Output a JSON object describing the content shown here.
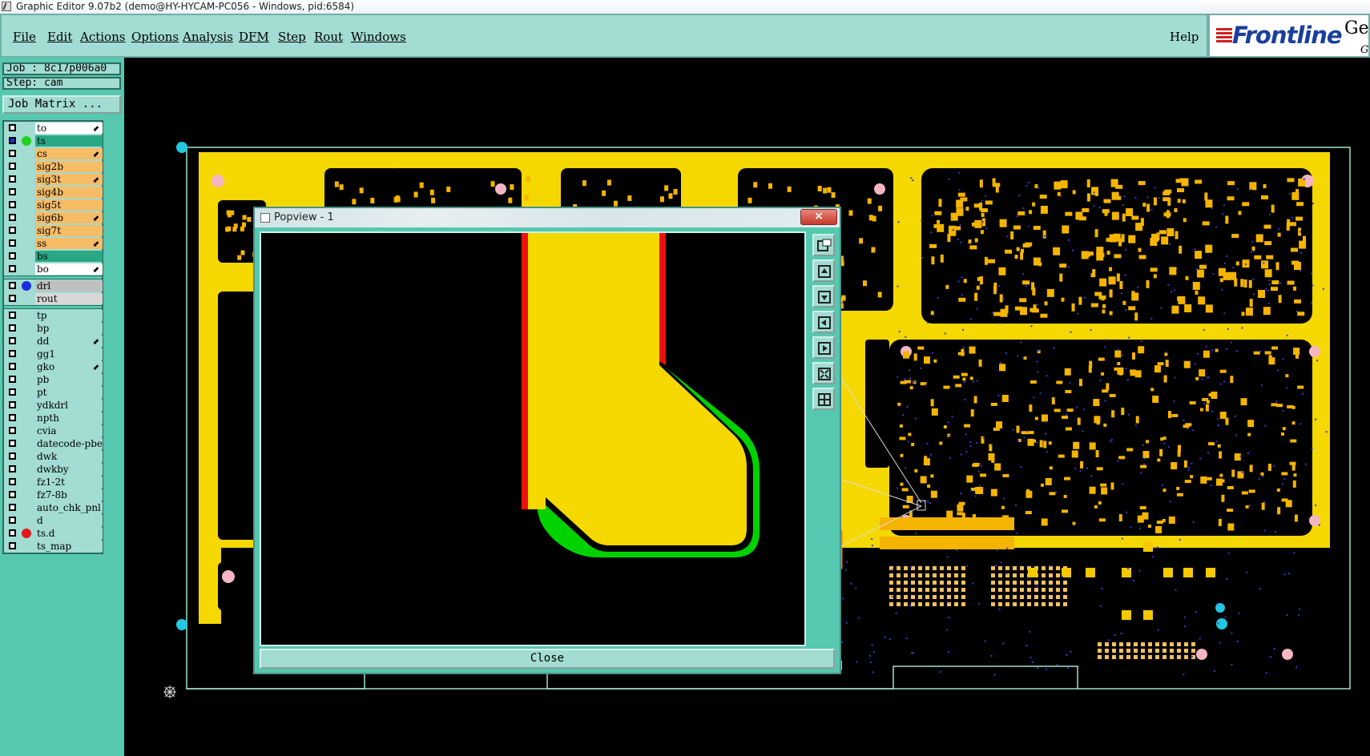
{
  "window": {
    "title": "Graphic Editor 9.07b2 (demo@HY-HYCAM-PC056 - Windows, pid:6584)"
  },
  "menu": {
    "items": [
      "File",
      "Edit",
      "Actions",
      "Options",
      "Analysis",
      "DFM",
      "Step",
      "Rout",
      "Windows"
    ],
    "help": "Help"
  },
  "logo": {
    "brand": "Frontline",
    "extra": "Ger",
    "sub": "G"
  },
  "job": {
    "job_label": "Job : 8c17p006a0",
    "step_label": "Step: cam",
    "matrix_button": "Job Matrix ..."
  },
  "layers": {
    "group1": [
      {
        "name": "to",
        "bg": "#ffffff",
        "arrow": true
      },
      {
        "name": "ts",
        "bg": "#2aa886",
        "dot": "#1ed21e",
        "arrow": false,
        "selected": true
      },
      {
        "name": "cs",
        "bg": "#f7bc66",
        "arrow": true
      },
      {
        "name": "sig2b",
        "bg": "#f7bc66",
        "arrow": false
      },
      {
        "name": "sig3t",
        "bg": "#f7bc66",
        "arrow": true
      },
      {
        "name": "sig4b",
        "bg": "#f7bc66",
        "arrow": false
      },
      {
        "name": "sig5t",
        "bg": "#f7bc66",
        "arrow": false
      },
      {
        "name": "sig6b",
        "bg": "#f7bc66",
        "arrow": true
      },
      {
        "name": "sig7t",
        "bg": "#f7bc66",
        "arrow": false
      },
      {
        "name": "ss",
        "bg": "#f7bc66",
        "arrow": true
      },
      {
        "name": "bs",
        "bg": "#2aa886",
        "arrow": false
      },
      {
        "name": "bo",
        "bg": "#ffffff",
        "arrow": true
      }
    ],
    "group2": [
      {
        "name": "drl",
        "bg": "#c0c0c0",
        "dot": "#1a2ee0",
        "arrow": false
      },
      {
        "name": "rout",
        "bg": "#d8d8d8",
        "arrow": false
      }
    ],
    "group3": [
      {
        "name": "tp",
        "bg": "#a2dcd2",
        "arrow": false
      },
      {
        "name": "bp",
        "bg": "#a2dcd2",
        "arrow": false
      },
      {
        "name": "dd",
        "bg": "#a2dcd2",
        "arrow": true
      },
      {
        "name": "gg1",
        "bg": "#a2dcd2",
        "arrow": false
      },
      {
        "name": "gko",
        "bg": "#a2dcd2",
        "arrow": true
      },
      {
        "name": "pb",
        "bg": "#a2dcd2",
        "arrow": false
      },
      {
        "name": "pt",
        "bg": "#a2dcd2",
        "arrow": false
      },
      {
        "name": "ydkdrl",
        "bg": "#a2dcd2",
        "arrow": false
      },
      {
        "name": "npth",
        "bg": "#a2dcd2",
        "arrow": false
      },
      {
        "name": "cvia",
        "bg": "#a2dcd2",
        "arrow": false
      },
      {
        "name": "datecode-pbe",
        "bg": "#a2dcd2",
        "arrow": false
      },
      {
        "name": "dwk",
        "bg": "#a2dcd2",
        "arrow": false
      },
      {
        "name": "dwkby",
        "bg": "#a2dcd2",
        "arrow": false
      },
      {
        "name": "fz1-2t",
        "bg": "#a2dcd2",
        "arrow": false
      },
      {
        "name": "fz7-8b",
        "bg": "#a2dcd2",
        "arrow": false
      },
      {
        "name": "auto_chk_pnl",
        "bg": "#a2dcd2",
        "arrow": false
      },
      {
        "name": "d",
        "bg": "#a2dcd2",
        "arrow": false
      },
      {
        "name": "ts.d",
        "bg": "#a2dcd2",
        "dot": "#e01a1a",
        "arrow": false
      },
      {
        "name": "ts_map",
        "bg": "#a2dcd2",
        "arrow": false
      }
    ]
  },
  "popview": {
    "title": "Popview - 1",
    "close_button": "Close",
    "close_x": "×"
  },
  "colors": {
    "accent": "#a2dcd2",
    "panel": "#56c8b0",
    "copper": "#f5d800",
    "mask": "#1a1a6a",
    "outline_red": "#ee1010",
    "outline_green": "#00d200"
  }
}
